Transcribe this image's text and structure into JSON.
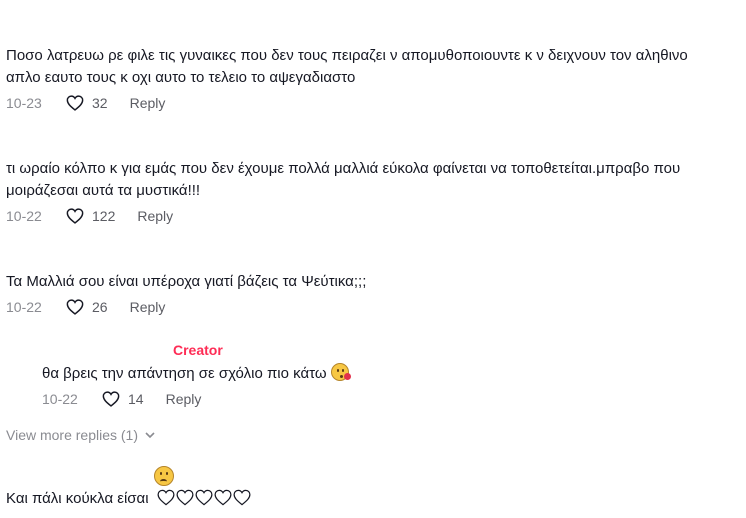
{
  "comments": [
    {
      "text": "Ποσο λατρευω ρε φιλε τις γυναικες που δεν τους πειραζει ν απομυθοποιουντε κ ν δειχνουν τον αληθινο απλο εαυτο τους κ οχι αυτο το τελειο το αψεγαδιαστο",
      "date": "10-23",
      "likes": "32",
      "reply_label": "Reply"
    },
    {
      "text": "τι ωραίο κόλπο κ για εμάς που δεν έχουμε πολλά μαλλιά εύκολα φαίνεται να τοποθετείται.μπραβο που μοιράζεσαι αυτά τα μυστικά!!!",
      "date": "10-22",
      "likes": "122",
      "reply_label": "Reply"
    },
    {
      "text": "Τα Μαλλιά σου είναι υπέροχα γιατί βάζεις τα Ψεύτικα;;;",
      "date": "10-22",
      "likes": "26",
      "reply_label": "Reply"
    }
  ],
  "creator_reply": {
    "badge": "Creator",
    "text": "θα βρεις την απάντηση σε σχόλιο πιο κάτω",
    "emoji": "kissing-face-icon",
    "date": "10-22",
    "likes": "14",
    "reply_label": "Reply"
  },
  "view_more": "View more replies (1)",
  "last_comment": {
    "text": "Και πάλι κούκλα είσαι",
    "emoji": "worried-face-icon",
    "hearts": 5
  },
  "colors": {
    "accent": "#fe2c55",
    "muted": "#8a8b91",
    "text": "#161823"
  }
}
